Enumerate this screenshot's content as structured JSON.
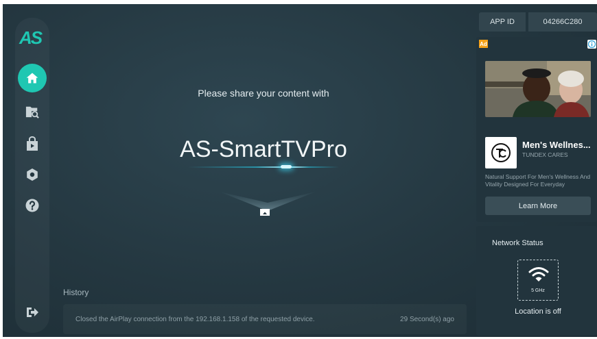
{
  "sidebar": {
    "logo": "AS",
    "items": [
      {
        "name": "home",
        "icon": "home-icon",
        "active": true
      },
      {
        "name": "files",
        "icon": "folder-search-icon"
      },
      {
        "name": "cast",
        "icon": "share-bag-icon"
      },
      {
        "name": "settings",
        "icon": "gear-icon"
      },
      {
        "name": "help",
        "icon": "question-icon"
      }
    ],
    "exit_icon": "exit-icon"
  },
  "main": {
    "share_text": "Please share your content with",
    "device_name": "AS-SmartTVPro",
    "airplay_icon": "airplay-icon"
  },
  "history": {
    "title": "History",
    "rows": [
      {
        "message": "Closed the AirPlay connection from the 192.168.1.158 of the requested device.",
        "time": "29 Second(s) ago"
      }
    ]
  },
  "app_id": {
    "label": "APP ID",
    "value": "04266C280"
  },
  "ad": {
    "badge": "Ad",
    "title": "Men's Wellnes...",
    "subtitle": "TUNDEX CARES",
    "description": "Natural Support For Men's Wellness And Vitality Designed For Everyday",
    "cta": "Learn More"
  },
  "network": {
    "title": "Network Status",
    "band": "5 GHz",
    "location": "Location is off"
  },
  "colors": {
    "accent": "#1fc7b2",
    "background": "#243740",
    "panel": "#22343d"
  }
}
